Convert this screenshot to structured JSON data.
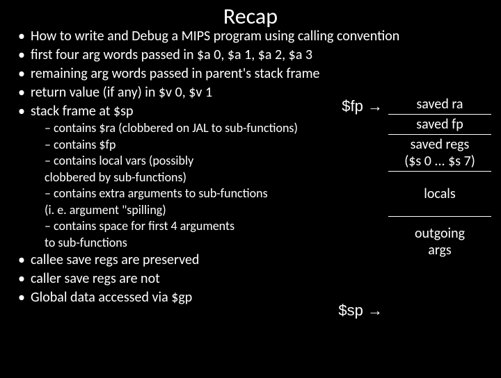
{
  "title": "Recap",
  "bullets": {
    "b1": "How to write and Debug a MIPS program using calling convention",
    "b2": "first four arg words passed in $a 0, $a 1, $a 2, $a 3",
    "b3": "remaining arg words passed in parent's stack frame",
    "b4": "return value (if any) in $v 0, $v 1",
    "b5": "stack frame at $sp",
    "b6": "callee save regs are preserved",
    "b7": "caller save regs  are not",
    "b8": "Global data accessed via $gp"
  },
  "subs": {
    "s1": "– contains $ra (clobbered on JAL  to sub-functions)",
    "s2": "–  contains $fp",
    "s3": "– contains local vars (possibly",
    "s3b": "clobbered by sub-functions)",
    "s4": "– contains extra arguments to sub-functions",
    "s4b": "(i. e. argument \"spilling)",
    "s5": "– contains space for first 4 arguments",
    "s5b": "to sub-functions"
  },
  "frame": {
    "r1": "saved ra",
    "r2": "saved fp",
    "r3a": "saved regs",
    "r3b": "($s 0  ... $s 7)",
    "r4": "locals",
    "r5a": "outgoing",
    "r5b": "args"
  },
  "labels": {
    "fp": "$fp →",
    "sp": "$sp →"
  }
}
